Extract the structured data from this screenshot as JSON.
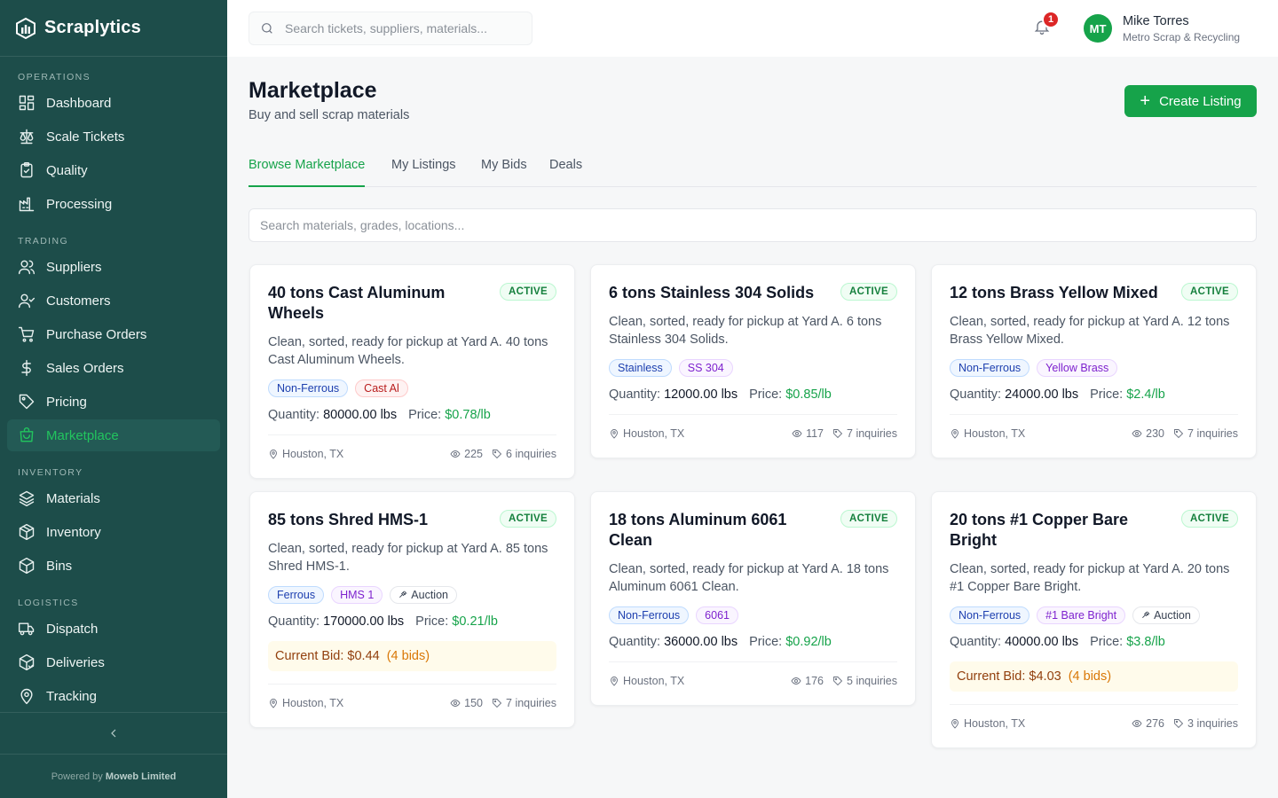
{
  "app": {
    "name": "Scraplytics"
  },
  "sidebar": {
    "sections": [
      {
        "title": "OPERATIONS",
        "items": [
          {
            "label": "Dashboard",
            "icon": "dashboard-icon"
          },
          {
            "label": "Scale Tickets",
            "icon": "scale-icon"
          },
          {
            "label": "Quality",
            "icon": "clipboard-check-icon"
          },
          {
            "label": "Processing",
            "icon": "factory-icon"
          }
        ]
      },
      {
        "title": "TRADING",
        "items": [
          {
            "label": "Suppliers",
            "icon": "users-icon"
          },
          {
            "label": "Customers",
            "icon": "user-check-icon"
          },
          {
            "label": "Purchase Orders",
            "icon": "cart-icon"
          },
          {
            "label": "Sales Orders",
            "icon": "dollar-icon"
          },
          {
            "label": "Pricing",
            "icon": "tag-icon"
          },
          {
            "label": "Marketplace",
            "icon": "store-icon",
            "active": true
          }
        ]
      },
      {
        "title": "INVENTORY",
        "items": [
          {
            "label": "Materials",
            "icon": "layers-icon"
          },
          {
            "label": "Inventory",
            "icon": "package-icon"
          },
          {
            "label": "Bins",
            "icon": "box-icon"
          }
        ]
      },
      {
        "title": "LOGISTICS",
        "items": [
          {
            "label": "Dispatch",
            "icon": "truck-icon"
          },
          {
            "label": "Deliveries",
            "icon": "package-check-icon"
          },
          {
            "label": "Tracking",
            "icon": "map-pin-icon"
          }
        ]
      }
    ],
    "powered_prefix": "Powered by",
    "powered_company": "Moweb Limited"
  },
  "topbar": {
    "search_placeholder": "Search tickets, suppliers, materials...",
    "notification_count": "1",
    "user": {
      "initials": "MT",
      "name": "Mike Torres",
      "org": "Metro Scrap & Recycling"
    }
  },
  "header": {
    "title": "Marketplace",
    "subtitle": "Buy and sell scrap materials",
    "create_label": "Create Listing"
  },
  "tabs": [
    "Browse Marketplace",
    "My Listings",
    "My Bids",
    "Deals"
  ],
  "filter_placeholder": "Search materials, grades, locations...",
  "labels": {
    "quantity": "Quantity:",
    "price": "Price:",
    "current_bid": "Current Bid:"
  },
  "colors": {
    "sidebar_bg": "#1d4d4a",
    "accent": "#16a34a",
    "badge": "#dc2626"
  },
  "listings": [
    {
      "title": "40 tons Cast Aluminum Wheels",
      "status": "ACTIVE",
      "desc": "Clean, sorted, ready for pickup at Yard A. 40 tons Cast Aluminum Wheels.",
      "tags": [
        {
          "t": "Non-Ferrous",
          "c": "blue"
        },
        {
          "t": "Cast Al",
          "c": "red"
        }
      ],
      "quantity": "80000.00 lbs",
      "price": "$0.78/lb",
      "location": "Houston, TX",
      "views": "225",
      "inquiries": "6 inquiries"
    },
    {
      "title": "6 tons Stainless 304 Solids",
      "status": "ACTIVE",
      "desc": "Clean, sorted, ready for pickup at Yard A. 6 tons Stainless 304 Solids.",
      "tags": [
        {
          "t": "Stainless",
          "c": "blue"
        },
        {
          "t": "SS 304",
          "c": "purple"
        }
      ],
      "quantity": "12000.00 lbs",
      "price": "$0.85/lb",
      "location": "Houston, TX",
      "views": "117",
      "inquiries": "7 inquiries"
    },
    {
      "title": "12 tons Brass Yellow Mixed",
      "status": "ACTIVE",
      "desc": "Clean, sorted, ready for pickup at Yard A. 12 tons Brass Yellow Mixed.",
      "tags": [
        {
          "t": "Non-Ferrous",
          "c": "blue"
        },
        {
          "t": "Yellow Brass",
          "c": "purple"
        }
      ],
      "quantity": "24000.00 lbs",
      "price": "$2.4/lb",
      "location": "Houston, TX",
      "views": "230",
      "inquiries": "7 inquiries"
    },
    {
      "title": "85 tons Shred HMS-1",
      "status": "ACTIVE",
      "desc": "Clean, sorted, ready for pickup at Yard A. 85 tons Shred HMS-1.",
      "tags": [
        {
          "t": "Ferrous",
          "c": "blue"
        },
        {
          "t": "HMS 1",
          "c": "purple"
        },
        {
          "t": "Auction",
          "c": "gray",
          "icon": "gavel-icon"
        }
      ],
      "quantity": "170000.00 lbs",
      "price": "$0.21/lb",
      "bid": {
        "amount": "$0.44",
        "count": "(4 bids)"
      },
      "location": "Houston, TX",
      "views": "150",
      "inquiries": "7 inquiries"
    },
    {
      "title": "18 tons Aluminum 6061 Clean",
      "status": "ACTIVE",
      "desc": "Clean, sorted, ready for pickup at Yard A. 18 tons Aluminum 6061 Clean.",
      "tags": [
        {
          "t": "Non-Ferrous",
          "c": "blue"
        },
        {
          "t": "6061",
          "c": "purple"
        }
      ],
      "quantity": "36000.00 lbs",
      "price": "$0.92/lb",
      "location": "Houston, TX",
      "views": "176",
      "inquiries": "5 inquiries"
    },
    {
      "title": "20 tons #1 Copper Bare Bright",
      "status": "ACTIVE",
      "desc": "Clean, sorted, ready for pickup at Yard A. 20 tons #1 Copper Bare Bright.",
      "tags": [
        {
          "t": "Non-Ferrous",
          "c": "blue"
        },
        {
          "t": "#1 Bare Bright",
          "c": "purple"
        },
        {
          "t": "Auction",
          "c": "gray",
          "icon": "gavel-icon"
        }
      ],
      "quantity": "40000.00 lbs",
      "price": "$3.8/lb",
      "bid": {
        "amount": "$4.03",
        "count": "(4 bids)"
      },
      "location": "Houston, TX",
      "views": "276",
      "inquiries": "3 inquiries"
    }
  ]
}
